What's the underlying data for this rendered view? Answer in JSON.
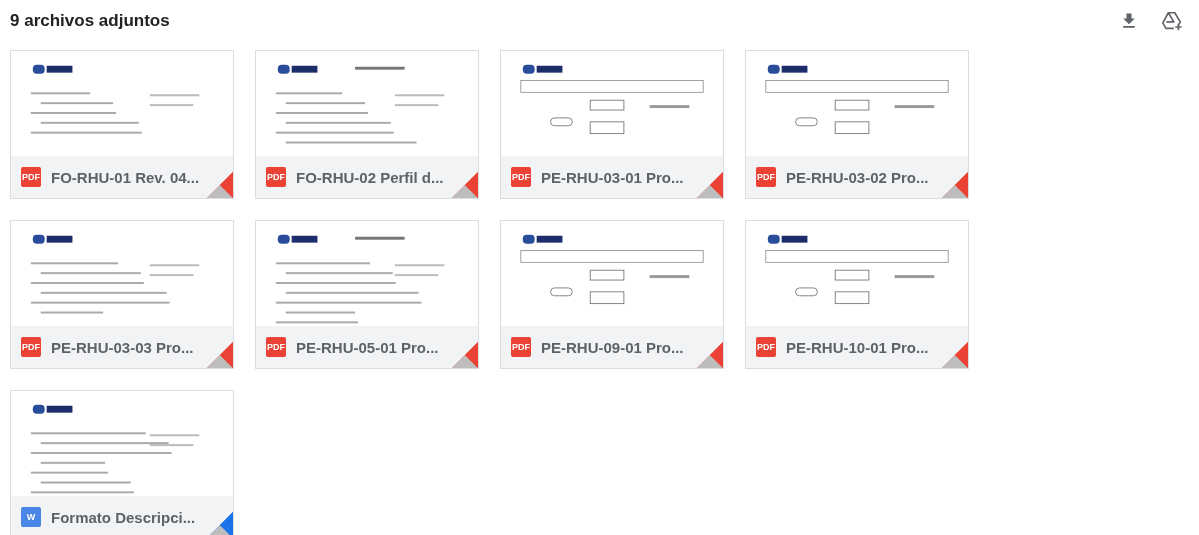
{
  "header": {
    "title": "9 archivos adjuntos"
  },
  "attachments": [
    {
      "name": "FO-RHU-01 Rev. 04...",
      "kind": "pdf",
      "badge": "PDF"
    },
    {
      "name": "FO-RHU-02 Perfil d...",
      "kind": "pdf",
      "badge": "PDF"
    },
    {
      "name": "PE-RHU-03-01 Pro...",
      "kind": "pdf",
      "badge": "PDF"
    },
    {
      "name": "PE-RHU-03-02 Pro...",
      "kind": "pdf",
      "badge": "PDF"
    },
    {
      "name": "PE-RHU-03-03 Pro...",
      "kind": "pdf",
      "badge": "PDF"
    },
    {
      "name": "PE-RHU-05-01 Pro...",
      "kind": "pdf",
      "badge": "PDF"
    },
    {
      "name": "PE-RHU-09-01 Pro...",
      "kind": "pdf",
      "badge": "PDF"
    },
    {
      "name": "PE-RHU-10-01 Pro...",
      "kind": "pdf",
      "badge": "PDF"
    },
    {
      "name": "Formato Descripci...",
      "kind": "word",
      "badge": "W"
    }
  ]
}
